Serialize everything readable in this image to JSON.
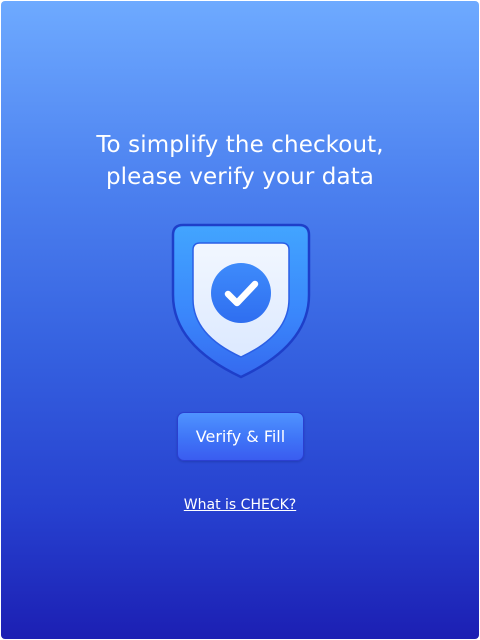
{
  "heading": {
    "line1": "To simplify the checkout,",
    "line2": "please verify your data"
  },
  "icon": {
    "name": "shield-check-icon"
  },
  "actions": {
    "verify_label": "Verify & Fill",
    "help_link_label": "What is CHECK?"
  },
  "colors": {
    "background_top": "#6eaaff",
    "background_bottom": "#1c1fb3",
    "button": "#3f74f7",
    "shield_outer": "#3b8cff",
    "shield_border": "#1e3fc9",
    "check_circle": "#3b82f6"
  }
}
